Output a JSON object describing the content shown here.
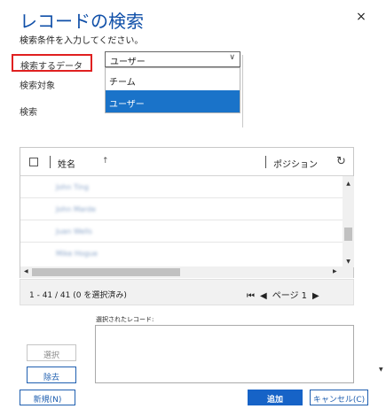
{
  "dialog": {
    "title": "レコードの検索",
    "close_icon": "×",
    "subtitle": "検索条件を入力してください。"
  },
  "form": {
    "look_for_label": "検索するデータ",
    "look_in_label": "検索対象",
    "search_label": "検索",
    "look_for_value": "ユーザー",
    "look_for_options": [
      {
        "label": "チーム",
        "selected": false
      },
      {
        "label": "ユーザー",
        "selected": true
      }
    ]
  },
  "grid": {
    "columns": [
      "姓名",
      "ポジション"
    ],
    "sort_icon": "↑",
    "refresh_icon": "↻",
    "rows": [
      "John Ting",
      "John Marde",
      "Juan Wells",
      "Mike Hogue"
    ]
  },
  "footer": {
    "selection_count": "1 - 41 / 41 (0 を選択済み)",
    "first_page_icon": "⏮",
    "prev_page_icon": "◀",
    "page_label": "ページ 1",
    "next_page_icon": "▶"
  },
  "selected": {
    "label": "選択されたレコード:",
    "select_button": "選択",
    "remove_button": "除去"
  },
  "actions": {
    "new_button": "新規(N)",
    "add_button": "追加",
    "cancel_button": "キャンセル(C)"
  },
  "colors": {
    "title": "#0f4fa8",
    "highlight_border": "#e02020",
    "selected_option": "#1a73c9",
    "primary_button": "#1663c7"
  }
}
